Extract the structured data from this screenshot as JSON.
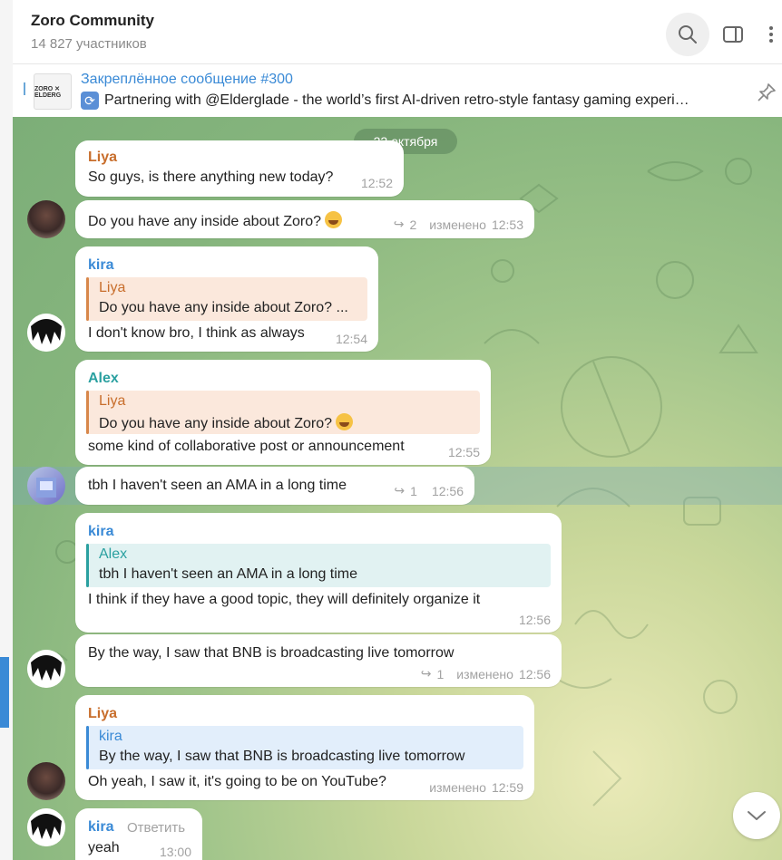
{
  "header": {
    "title": "Zoro Community",
    "subtitle": "14 827 участников"
  },
  "pinned": {
    "title": "Закреплённое сообщение #300",
    "thumb_text": "ZORO ✕ ELDERG",
    "text": "Partnering with @Elderglade - the world’s first AI-driven retro-style fantasy gaming experi…"
  },
  "chat": {
    "date": "22 октября",
    "messages": [
      {
        "name": "Liya",
        "text": "So guys, is there anything new today?",
        "time": "12:52"
      },
      {
        "text": "Do you have any inside about Zoro?",
        "replies": "2",
        "edited": "изменено",
        "time": "12:53"
      },
      {
        "name": "kira",
        "reply_name": "Liya",
        "reply_text": "Do you have any inside about Zoro? ...",
        "text": "I don't know bro, I think as always",
        "time": "12:54"
      },
      {
        "name": "Alex",
        "reply_name": "Liya",
        "reply_text": "Do you have any inside about Zoro?",
        "text": "some kind of collaborative post or announcement",
        "time": "12:55"
      },
      {
        "text": "tbh I haven't seen an AMA in a long time",
        "replies": "1",
        "time": "12:56"
      },
      {
        "name": "kira",
        "reply_name": "Alex",
        "reply_text": "tbh I haven't seen an AMA in a long time",
        "text": "I think if they have a good topic, they will definitely organize it",
        "time": "12:56"
      },
      {
        "text": "By the way, I saw that BNB is broadcasting live tomorrow",
        "replies": "1",
        "edited": "изменено",
        "time": "12:56"
      },
      {
        "name": "Liya",
        "reply_name": "kira",
        "reply_text": "By the way, I saw that BNB is broadcasting live tomorrow",
        "text": "Oh yeah, I saw it, it's going to be on YouTube?",
        "edited": "изменено",
        "time": "12:59"
      },
      {
        "name": "kira",
        "reply_action": "Ответить",
        "text": "yeah",
        "time": "13:00"
      }
    ]
  }
}
